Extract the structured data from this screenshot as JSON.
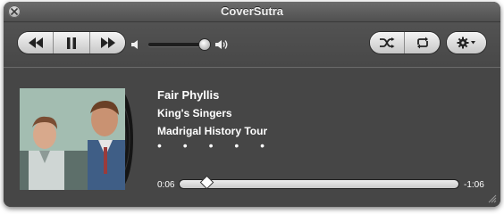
{
  "window": {
    "title": "CoverSutra"
  },
  "player": {
    "track_title": "Fair Phyllis",
    "artist": "King's Singers",
    "album": "Madrigal History Tour",
    "rating_dots": "• • • • •",
    "elapsed": "0:06",
    "remaining": "-1:06",
    "progress_fraction": 0.09,
    "volume_fraction": 0.95
  },
  "icons": {
    "close": "close-icon",
    "rewind": "rewind-icon",
    "pause": "pause-icon",
    "fast_forward": "fast-forward-icon",
    "volume_low": "speaker-low-icon",
    "volume_high": "speaker-high-icon",
    "shuffle": "shuffle-icon",
    "repeat": "repeat-icon",
    "settings": "gear-icon"
  },
  "colors": {
    "window_bg": "#4a4a4a",
    "text": "#ffffff"
  }
}
